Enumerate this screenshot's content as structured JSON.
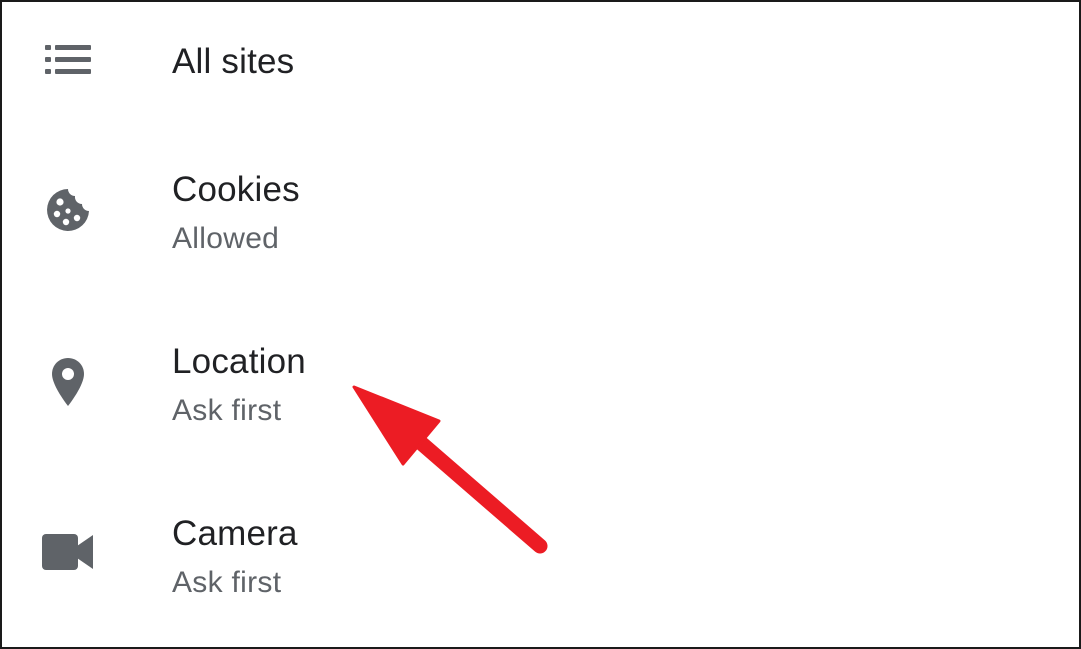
{
  "site_settings": {
    "items": [
      {
        "id": "all-sites",
        "title": "All sites",
        "icon": "list-icon"
      },
      {
        "id": "cookies",
        "title": "Cookies",
        "summary": "Allowed",
        "icon": "cookie-icon"
      },
      {
        "id": "location",
        "title": "Location",
        "summary": "Ask first",
        "icon": "location-pin-icon"
      },
      {
        "id": "camera",
        "title": "Camera",
        "summary": "Ask first",
        "icon": "video-camera-icon"
      }
    ]
  },
  "colors": {
    "icon": "#5f6368",
    "title": "#202124",
    "summary": "#5f6368",
    "annotation_arrow": "#ec1c24",
    "frame_border": "#1a1a1a"
  },
  "annotation": {
    "type": "arrow",
    "points_to": "location"
  }
}
